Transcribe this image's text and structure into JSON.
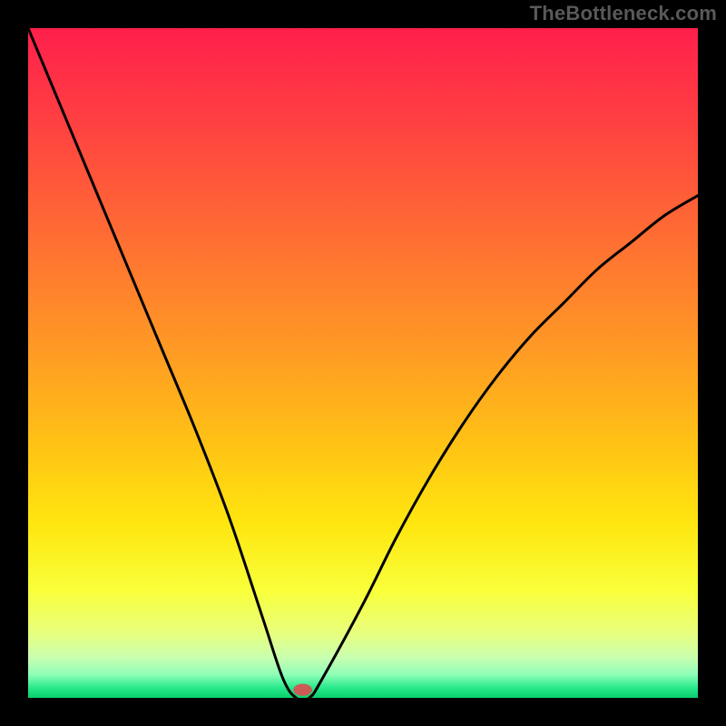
{
  "watermark": "TheBottleneck.com",
  "chart_data": {
    "type": "line",
    "title": "",
    "xlabel": "",
    "ylabel": "",
    "xlim": [
      0,
      100
    ],
    "ylim": [
      0,
      100
    ],
    "x": [
      0,
      5,
      10,
      15,
      20,
      25,
      30,
      35,
      38,
      40,
      42,
      44,
      50,
      55,
      60,
      65,
      70,
      75,
      80,
      85,
      90,
      95,
      100
    ],
    "values": [
      100,
      88,
      76,
      64,
      52,
      40,
      27,
      12,
      3,
      0,
      0,
      3,
      14,
      24,
      33,
      41,
      48,
      54,
      59,
      64,
      68,
      72,
      75
    ],
    "marker": {
      "x": 41,
      "y": 1.2,
      "rx": 1.4,
      "ry": 0.9,
      "color": "#cc5b55"
    },
    "gradient_stops": [
      {
        "offset": 0.0,
        "color": "#ff1f4b"
      },
      {
        "offset": 0.12,
        "color": "#ff3b43"
      },
      {
        "offset": 0.3,
        "color": "#ff6a34"
      },
      {
        "offset": 0.48,
        "color": "#ff9a24"
      },
      {
        "offset": 0.62,
        "color": "#ffc215"
      },
      {
        "offset": 0.74,
        "color": "#ffe60f"
      },
      {
        "offset": 0.84,
        "color": "#f8ff3a"
      },
      {
        "offset": 0.9,
        "color": "#eaff7a"
      },
      {
        "offset": 0.94,
        "color": "#c9ffb0"
      },
      {
        "offset": 0.965,
        "color": "#8fffb8"
      },
      {
        "offset": 0.985,
        "color": "#28e88b"
      },
      {
        "offset": 1.0,
        "color": "#07cf6b"
      }
    ],
    "curve_color": "#000000",
    "curve_width": 3
  }
}
